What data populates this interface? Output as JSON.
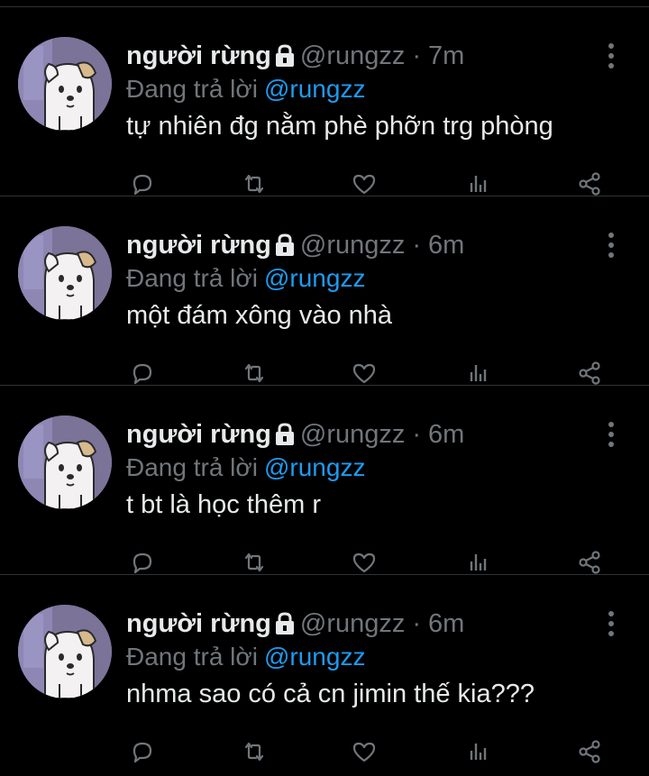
{
  "colors": {
    "background": "#000000",
    "text": "#e7e9ea",
    "muted": "#71767b",
    "link": "#1d9bf0",
    "divider": "#2f3336"
  },
  "icons": [
    "lock-icon",
    "more-vertical-icon",
    "reply-icon",
    "retweet-icon",
    "like-icon",
    "views-icon",
    "share-icon"
  ],
  "tweets": [
    {
      "name": "người rừng",
      "handle": "@rungzz",
      "separator": "·",
      "time": "7m",
      "reply_prefix": "Đang trả lời",
      "reply_to": "@rungzz",
      "text": "tự nhiên đg nằm phè phỡn trg phòng"
    },
    {
      "name": "người rừng",
      "handle": "@rungzz",
      "separator": "·",
      "time": "6m",
      "reply_prefix": "Đang trả lời",
      "reply_to": "@rungzz",
      "text": "một đám xông vào nhà"
    },
    {
      "name": "người rừng",
      "handle": "@rungzz",
      "separator": "·",
      "time": "6m",
      "reply_prefix": "Đang trả lời",
      "reply_to": "@rungzz",
      "text": "t bt là học thêm r"
    },
    {
      "name": "người rừng",
      "handle": "@rungzz",
      "separator": "·",
      "time": "6m",
      "reply_prefix": "Đang trả lời",
      "reply_to": "@rungzz",
      "text": "nhma sao có cả cn jimin thế kia???"
    }
  ]
}
